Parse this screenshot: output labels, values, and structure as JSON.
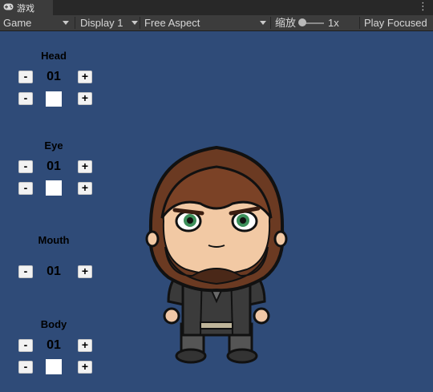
{
  "tab": {
    "label": "游戏",
    "icon": "gamepad-icon",
    "menu_icon": "kebab-menu-icon"
  },
  "toolbar": {
    "view_select": "Game",
    "display_select": "Display 1",
    "aspect_select": "Free Aspect",
    "scale_label": "缩放",
    "scale_value": "1x",
    "play_mode": "Play Focused"
  },
  "groups": [
    {
      "label": "Head",
      "index": "01",
      "has_color": true
    },
    {
      "label": "Eye",
      "index": "01",
      "has_color": true
    },
    {
      "label": "Mouth",
      "index": "01",
      "has_color": false
    },
    {
      "label": "Body",
      "index": "01",
      "has_color": true
    }
  ],
  "buttons": {
    "minus": "-",
    "plus": "+"
  },
  "colors": {
    "game_background": "#2f4b78",
    "toolbar": "#3c3c3c",
    "swatch": "#ffffff"
  }
}
